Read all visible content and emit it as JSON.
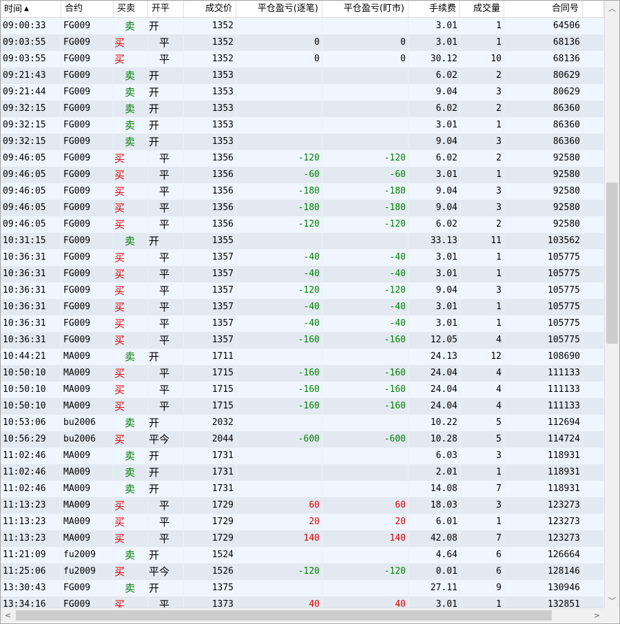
{
  "columns": [
    {
      "label": "时间",
      "align": "l"
    },
    {
      "label": "合约",
      "align": "l"
    },
    {
      "label": "买卖",
      "align": "l"
    },
    {
      "label": "开平",
      "align": "l"
    },
    {
      "label": "成交价",
      "align": "r"
    },
    {
      "label": "平仓盈亏(逐笔)",
      "align": "r"
    },
    {
      "label": "平仓盈亏(盯市)",
      "align": "r"
    },
    {
      "label": "手续费",
      "align": "r"
    },
    {
      "label": "成交量",
      "align": "r"
    },
    {
      "label": "合同号",
      "align": "r"
    },
    {
      "label": "",
      "align": "l"
    }
  ],
  "sort_icon": "▲",
  "rows": [
    [
      "09:00:33",
      "FG009",
      "卖",
      "开",
      "1352",
      "",
      "",
      "3.01",
      "1",
      "64506"
    ],
    [
      "09:03:55",
      "FG009",
      "买",
      "平",
      "1352",
      "0",
      "0",
      "3.01",
      "1",
      "68136"
    ],
    [
      "09:03:55",
      "FG009",
      "买",
      "平",
      "1352",
      "0",
      "0",
      "30.12",
      "10",
      "68136"
    ],
    [
      "09:21:43",
      "FG009",
      "卖",
      "开",
      "1353",
      "",
      "",
      "6.02",
      "2",
      "80629"
    ],
    [
      "09:21:44",
      "FG009",
      "卖",
      "开",
      "1353",
      "",
      "",
      "9.04",
      "3",
      "80629"
    ],
    [
      "09:32:15",
      "FG009",
      "卖",
      "开",
      "1353",
      "",
      "",
      "6.02",
      "2",
      "86360"
    ],
    [
      "09:32:15",
      "FG009",
      "卖",
      "开",
      "1353",
      "",
      "",
      "3.01",
      "1",
      "86360"
    ],
    [
      "09:32:15",
      "FG009",
      "卖",
      "开",
      "1353",
      "",
      "",
      "9.04",
      "3",
      "86360"
    ],
    [
      "09:46:05",
      "FG009",
      "买",
      "平",
      "1356",
      "-120",
      "-120",
      "6.02",
      "2",
      "92580"
    ],
    [
      "09:46:05",
      "FG009",
      "买",
      "平",
      "1356",
      "-60",
      "-60",
      "3.01",
      "1",
      "92580"
    ],
    [
      "09:46:05",
      "FG009",
      "买",
      "平",
      "1356",
      "-180",
      "-180",
      "9.04",
      "3",
      "92580"
    ],
    [
      "09:46:05",
      "FG009",
      "买",
      "平",
      "1356",
      "-180",
      "-180",
      "9.04",
      "3",
      "92580"
    ],
    [
      "09:46:05",
      "FG009",
      "买",
      "平",
      "1356",
      "-120",
      "-120",
      "6.02",
      "2",
      "92580"
    ],
    [
      "10:31:15",
      "FG009",
      "卖",
      "开",
      "1355",
      "",
      "",
      "33.13",
      "11",
      "103562"
    ],
    [
      "10:36:31",
      "FG009",
      "买",
      "平",
      "1357",
      "-40",
      "-40",
      "3.01",
      "1",
      "105775"
    ],
    [
      "10:36:31",
      "FG009",
      "买",
      "平",
      "1357",
      "-40",
      "-40",
      "3.01",
      "1",
      "105775"
    ],
    [
      "10:36:31",
      "FG009",
      "买",
      "平",
      "1357",
      "-120",
      "-120",
      "9.04",
      "3",
      "105775"
    ],
    [
      "10:36:31",
      "FG009",
      "买",
      "平",
      "1357",
      "-40",
      "-40",
      "3.01",
      "1",
      "105775"
    ],
    [
      "10:36:31",
      "FG009",
      "买",
      "平",
      "1357",
      "-40",
      "-40",
      "3.01",
      "1",
      "105775"
    ],
    [
      "10:36:31",
      "FG009",
      "买",
      "平",
      "1357",
      "-160",
      "-160",
      "12.05",
      "4",
      "105775"
    ],
    [
      "10:44:21",
      "MA009",
      "卖",
      "开",
      "1711",
      "",
      "",
      "24.13",
      "12",
      "108690"
    ],
    [
      "10:50:10",
      "MA009",
      "买",
      "平",
      "1715",
      "-160",
      "-160",
      "24.04",
      "4",
      "111133"
    ],
    [
      "10:50:10",
      "MA009",
      "买",
      "平",
      "1715",
      "-160",
      "-160",
      "24.04",
      "4",
      "111133"
    ],
    [
      "10:50:10",
      "MA009",
      "买",
      "平",
      "1715",
      "-160",
      "-160",
      "24.04",
      "4",
      "111133"
    ],
    [
      "10:53:06",
      "bu2006",
      "卖",
      "开",
      "2032",
      "",
      "",
      "10.22",
      "5",
      "112694"
    ],
    [
      "10:56:29",
      "bu2006",
      "买",
      "平今",
      "2044",
      "-600",
      "-600",
      "10.28",
      "5",
      "114724"
    ],
    [
      "11:02:46",
      "MA009",
      "卖",
      "开",
      "1731",
      "",
      "",
      "6.03",
      "3",
      "118931"
    ],
    [
      "11:02:46",
      "MA009",
      "卖",
      "开",
      "1731",
      "",
      "",
      "2.01",
      "1",
      "118931"
    ],
    [
      "11:02:46",
      "MA009",
      "卖",
      "开",
      "1731",
      "",
      "",
      "14.08",
      "7",
      "118931"
    ],
    [
      "11:13:23",
      "MA009",
      "买",
      "平",
      "1729",
      "60",
      "60",
      "18.03",
      "3",
      "123273"
    ],
    [
      "11:13:23",
      "MA009",
      "买",
      "平",
      "1729",
      "20",
      "20",
      "6.01",
      "1",
      "123273"
    ],
    [
      "11:13:23",
      "MA009",
      "买",
      "平",
      "1729",
      "140",
      "140",
      "42.08",
      "7",
      "123273"
    ],
    [
      "11:21:09",
      "fu2009",
      "卖",
      "开",
      "1524",
      "",
      "",
      "4.64",
      "6",
      "126664"
    ],
    [
      "11:25:06",
      "fu2009",
      "买",
      "平今",
      "1526",
      "-120",
      "-120",
      "0.01",
      "6",
      "128146"
    ],
    [
      "13:30:43",
      "FG009",
      "卖",
      "开",
      "1375",
      "",
      "",
      "27.11",
      "9",
      "130946"
    ],
    [
      "13:34:16",
      "FG009",
      "买",
      "平",
      "1373",
      "40",
      "40",
      "3.01",
      "1",
      "132851"
    ]
  ],
  "scroll": {
    "up_icon": "up-arrow-icon",
    "down_icon": "down-arrow-icon",
    "left_icon": "left-arrow-icon",
    "right_icon": "right-arrow-icon"
  },
  "colors": {
    "sell": "#008000",
    "buy": "#e00000",
    "profit": "#e00000",
    "loss": "#008000",
    "row_alt": "#e3e9f1"
  }
}
